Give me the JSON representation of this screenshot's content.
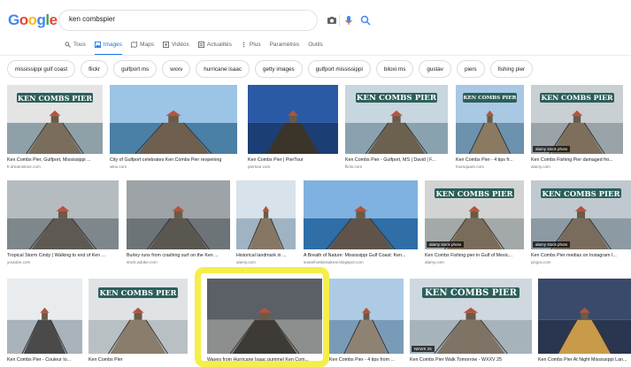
{
  "logo": {
    "letters": [
      "G",
      "o",
      "o",
      "g",
      "l",
      "e"
    ]
  },
  "search": {
    "query": "ken combspier"
  },
  "tabs": [
    {
      "label": "Tous",
      "icon": "search-icon",
      "active": false
    },
    {
      "label": "Images",
      "icon": "image-icon",
      "active": true
    },
    {
      "label": "Maps",
      "icon": "map-icon",
      "active": false
    },
    {
      "label": "Vidéos",
      "icon": "video-icon",
      "active": false
    },
    {
      "label": "Actualités",
      "icon": "news-icon",
      "active": false
    },
    {
      "label": "Plus",
      "icon": "more-icon",
      "active": false
    },
    {
      "label": "Paramètres",
      "icon": "",
      "active": false
    },
    {
      "label": "Outils",
      "icon": "",
      "active": false
    }
  ],
  "chips": [
    "mississippi gulf coast",
    "flickr",
    "gulfport ms",
    "wxxv",
    "hurricane isaac",
    "getty images",
    "gulfport mississippi",
    "biloxi ms",
    "gustav",
    "piers",
    "fishing pier"
  ],
  "results": [
    {
      "caption": "Ken Combs Pier, Gulfport, Mississippi ...",
      "source": "fr.dreamstime.com",
      "sign": "KEN COMBS PIER"
    },
    {
      "caption": "City of Gulfport celebrates Ken Combs Pier reopening",
      "source": "wlox.com",
      "sign": ""
    },
    {
      "caption": "Ken Combs Pier | PierTour",
      "source": "piertour.com",
      "sign": ""
    },
    {
      "caption": "Ken Combs Pier - Gulfport, MS | David | F...",
      "source": "flickr.com",
      "sign": "KEN COMBS PIER"
    },
    {
      "caption": "Ken Combs Pier - 4 tips fr...",
      "source": "foursquare.com",
      "sign": "KEN COMBS PIER"
    },
    {
      "caption": "Ken Combs Fishing Pier damaged fro...",
      "source": "alamy.com",
      "sign": "KEN COMBS PIER",
      "badge": "alamy stock photo"
    },
    {
      "caption": "Tropical Storm Cindy | Walking to end of Ken ...",
      "source": "youtube.com",
      "sign": ""
    },
    {
      "caption": "Burley runs from crashing surf on the Ken ...",
      "source": "stock.adobe.com",
      "sign": ""
    },
    {
      "caption": "Historical landmark in ...",
      "source": "alamy.com",
      "sign": ""
    },
    {
      "caption": "A Breath of Nature: Mississippi Gulf Coast: Ken...",
      "source": "susanhoskinsalone.blogspot.com",
      "sign": ""
    },
    {
      "caption": "Ken Combs Fishing pier in Gulf of Mexic...",
      "source": "alamy.com",
      "sign": "KEN COMBS PIER",
      "badge": "alamy stock photo"
    },
    {
      "caption": "Ken Combs Pier medias on Instagram I...",
      "source": "picgra.com",
      "sign": "KEN COMBS PIER",
      "badge": "alamy stock photo"
    },
    {
      "caption": "Ken Combs Pier - Couleur Io...",
      "source": "",
      "sign": ""
    },
    {
      "caption": "Ken Combs Pier",
      "source": "",
      "sign": "KEN COMBS PIER"
    },
    {
      "caption": "Waves from Hurricane Isaac pummel Ken Com...",
      "source": "",
      "sign": ""
    },
    {
      "caption": "Ken Combs Pier - 4 tips from ...",
      "source": "",
      "sign": ""
    },
    {
      "caption": "Ken Combs Pier Walk Tomorrow - WXXV 25",
      "source": "",
      "sign": "KEN COMBS PIER",
      "badge": "NEWS 25"
    },
    {
      "caption": "Ken Combs Pier At Night Mississippi Lan...",
      "source": "",
      "sign": ""
    }
  ],
  "colors": {
    "accent": "#1a73e8",
    "highlight": "#f5eb28",
    "sign": "#2c5f5a"
  }
}
